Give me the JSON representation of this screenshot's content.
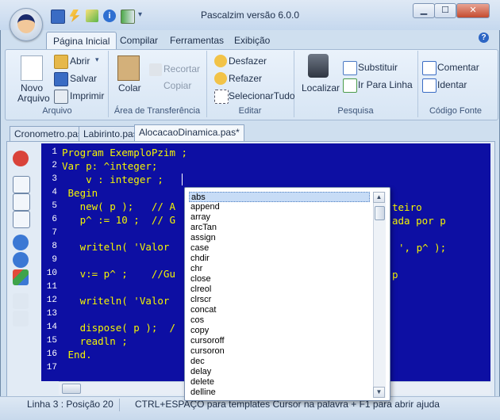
{
  "window": {
    "title": "Pascalzim versão 6.0.0"
  },
  "titlebar_buttons": {
    "minimize": "▁",
    "maximize": "☐",
    "close": "✕"
  },
  "quick_access": [
    "save-icon",
    "lightning-icon",
    "compile-run-icon",
    "info-icon",
    "exit-icon"
  ],
  "ribbon_tabs": [
    "Página Inicial",
    "Compilar",
    "Ferramentas",
    "Exibição"
  ],
  "ribbon": {
    "arquivo": {
      "label": "Arquivo",
      "novo": "Novo",
      "novo2": "Arquivo",
      "abrir": "Abrir",
      "salvar": "Salvar",
      "imprimir": "Imprimir"
    },
    "transferencia": {
      "label": "Área de Transferência",
      "colar": "Colar",
      "recortar": "Recortar",
      "copiar": "Copiar"
    },
    "editar": {
      "label": "Editar",
      "desfazer": "Desfazer",
      "refazer": "Refazer",
      "selecionar": "SelecionarTudo"
    },
    "pesquisa": {
      "label": "Pesquisa",
      "localizar": "Localizar",
      "substituir": "Substituir",
      "irpara": "Ir Para Linha"
    },
    "codigo": {
      "label": "Código Fonte",
      "comentar": "Comentar",
      "identar": "Identar"
    }
  },
  "doc_tabs": [
    "Cronometro.pas",
    "Labirinto.pas",
    "AlocacaoDinamica.pas*"
  ],
  "code": {
    "line_numbers": [
      "1",
      "2",
      "3",
      "4",
      "5",
      "6",
      "7",
      "8",
      "9",
      "10",
      "11",
      "12",
      "13",
      "14",
      "15",
      "16",
      "17"
    ],
    "lines": [
      "Program ExemploPzim ;",
      "Var p: ^integer;",
      "    v : integer ;",
      " Begin",
      "   new( p );   // A",
      "   p^ := 10 ;  // G",
      "",
      "   writeln( 'Valor",
      "",
      "   v:= p^ ;    //Gu",
      "",
      "   writeln( 'Valor",
      "",
      "   dispose( p );  /",
      "   readln ;",
      " End.",
      ""
    ],
    "right_fragments": {
      "line5": "teiro",
      "line6": "ada por p",
      "line8": "', p^ );",
      "line10": "p"
    }
  },
  "autocomplete": {
    "items": [
      "abs",
      "append",
      "array",
      "arcTan",
      "assign",
      "case",
      "chdir",
      "chr",
      "close",
      "clreol",
      "clrscr",
      "concat",
      "cos",
      "copy",
      "cursoroff",
      "cursoron",
      "dec",
      "delay",
      "delete",
      "delline"
    ],
    "selected": "abs"
  },
  "status": {
    "position": "Linha 3 : Posição 20",
    "hint": "CTRL+ESPAÇO para templates     Cursor na palavra + F1 para abrir ajuda"
  },
  "colors": {
    "editor_bg": "#0d0fa3",
    "code_text": "#f5f500",
    "accent": "#2d66c4"
  }
}
